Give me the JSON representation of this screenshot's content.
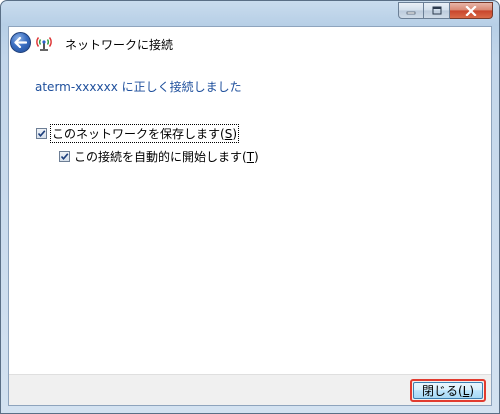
{
  "window": {
    "title": "ネットワークに接続",
    "caption": {
      "minimize_icon": "minimize-icon",
      "maximize_icon": "maximize-icon",
      "close_icon": "close-icon"
    }
  },
  "nav": {
    "back_icon": "back-arrow-icon",
    "network_icon": "wireless-network-icon"
  },
  "message": {
    "success_text": "aterm-xxxxxx に正しく接続しました"
  },
  "options": {
    "save_network": {
      "label_main": "このネットワークを保存します(",
      "accelerator": "S",
      "label_end": ")",
      "checked": true
    },
    "auto_start": {
      "label_main": "この接続を自動的に開始します(",
      "accelerator": "T",
      "label_end": ")",
      "checked": true
    }
  },
  "footer": {
    "close_button": {
      "label_main": "閉じる(",
      "accelerator": "L",
      "label_end": ")"
    }
  },
  "colors": {
    "link_blue": "#1e4f9c",
    "highlight_red": "#e13b2f"
  }
}
